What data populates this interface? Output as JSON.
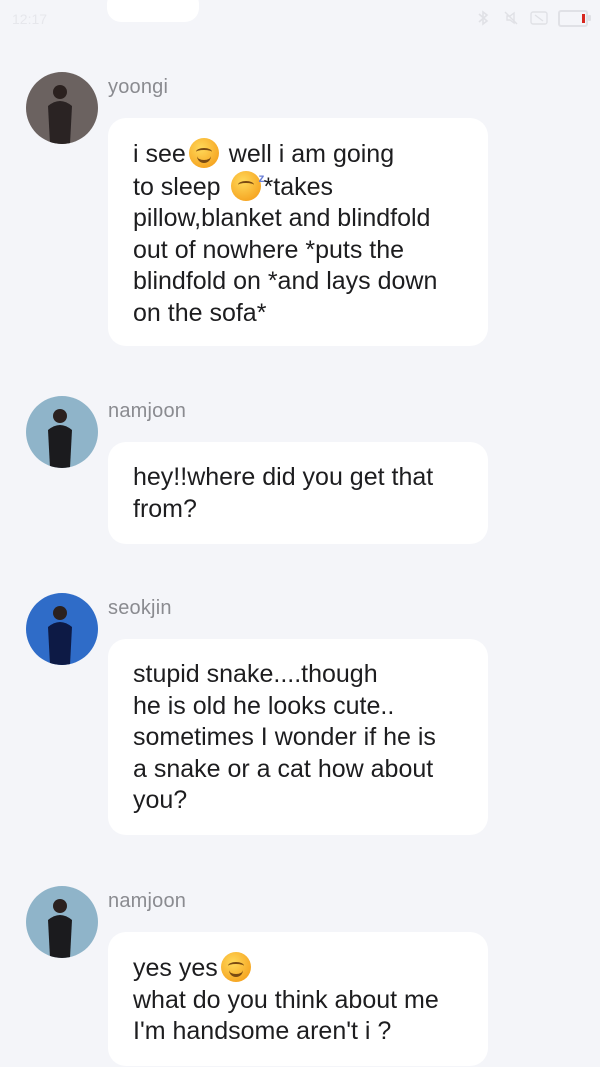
{
  "status_bar": {
    "time": "12:17",
    "icons": [
      "bluetooth-icon",
      "mute-icon",
      "sim-icon"
    ],
    "battery_alert_color": "#d7261e"
  },
  "theme": {
    "background": "#f4f5f9",
    "bubble": "#ffffff",
    "sender_color": "#8a8b90",
    "text_color": "#1d1d1f"
  },
  "messages": [
    {
      "sender": "yoongi",
      "avatar_colors": [
        "#6b6260",
        "#2a2323"
      ],
      "lines": [
        {
          "pre": "i see",
          "emoji": "smiling-face-emoji",
          "post": " well i am going"
        },
        {
          "pre": "to sleep ",
          "emoji": "sleeping-face-emoji",
          "post": "*takes"
        },
        {
          "pre": "pillow,blanket  and blindfold"
        },
        {
          "pre": "out of nowhere *puts the"
        },
        {
          "pre": "blindfold on *and lays down"
        },
        {
          "pre": "on the sofa*"
        }
      ]
    },
    {
      "sender": "namjoon",
      "avatar_colors": [
        "#8fb4c9",
        "#1b1b1e"
      ],
      "lines": [
        {
          "pre": "hey!!where did you get that"
        },
        {
          "pre": "from?"
        }
      ]
    },
    {
      "sender": "seokjin",
      "avatar_colors": [
        "#2f6cc8",
        "#0d1a45"
      ],
      "lines": [
        {
          "pre": "stupid snake....though"
        },
        {
          "pre": "he is old he looks cute.."
        },
        {
          "pre": "sometimes I wonder if he is"
        },
        {
          "pre": "a snake or a cat how about"
        },
        {
          "pre": "you?"
        }
      ]
    },
    {
      "sender": "namjoon",
      "avatar_colors": [
        "#8fb4c9",
        "#1b1b1e"
      ],
      "lines": [
        {
          "pre": "yes yes",
          "emoji": "smiling-face-emoji",
          "post": ""
        },
        {
          "pre": "what do you think about me"
        },
        {
          "pre": "I'm handsome aren't i ?"
        }
      ]
    }
  ]
}
